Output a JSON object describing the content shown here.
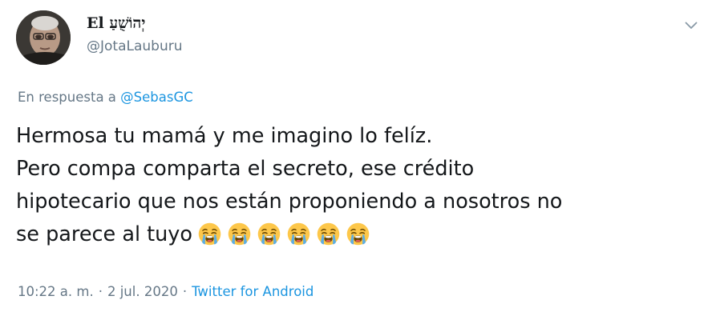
{
  "author": {
    "display_name": "El יְהוֹשֻׁעַ",
    "handle": "@JotaLauburu"
  },
  "reply": {
    "prefix": "En respuesta a",
    "mention": "@SebasGC"
  },
  "tweet": {
    "lines": [
      "Hermosa tu mamá y me imagino lo felíz.",
      "Pero compa comparta el secreto, ese crédito",
      "hipotecario que nos están proponiendo a nosotros no",
      "se parece al tuyo"
    ],
    "emoji_name": "loudly-crying-face-icon",
    "emoji_count": 6
  },
  "meta": {
    "time": "10:22 a. m.",
    "separator": "·",
    "date": "2 jul. 2020",
    "source": "Twitter for Android"
  },
  "colors": {
    "text": "#14171a",
    "secondary": "#657786",
    "link": "#1b95e0",
    "emoji_face": "#fdc74a",
    "emoji_tears": "#5dade2"
  }
}
